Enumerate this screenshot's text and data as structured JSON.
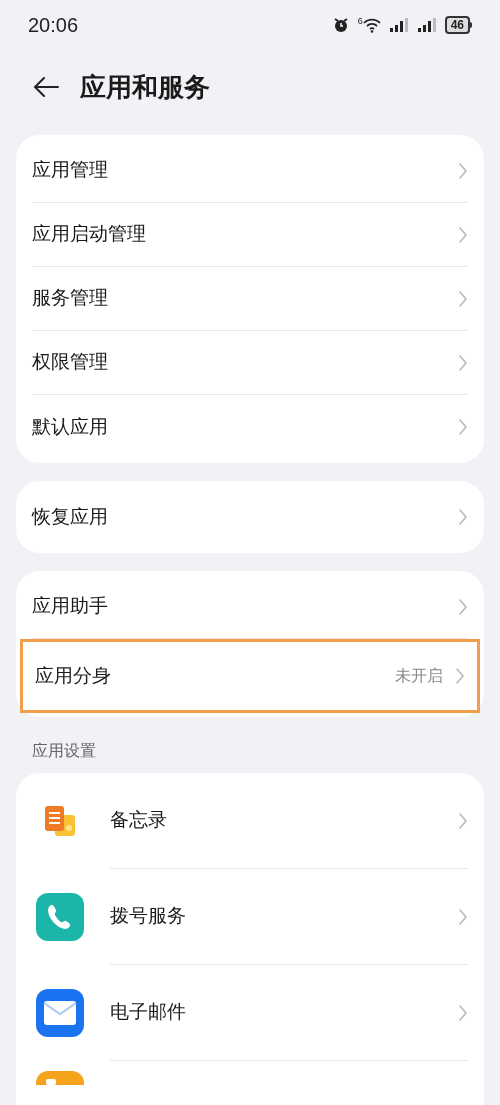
{
  "status_bar": {
    "time": "20:06",
    "alarm_superscript": "6",
    "battery": "46"
  },
  "header": {
    "title": "应用和服务"
  },
  "groups": [
    {
      "items": [
        {
          "label": "应用管理"
        },
        {
          "label": "应用启动管理"
        },
        {
          "label": "服务管理"
        },
        {
          "label": "权限管理"
        },
        {
          "label": "默认应用"
        }
      ]
    },
    {
      "items": [
        {
          "label": "恢复应用"
        }
      ]
    },
    {
      "items": [
        {
          "label": "应用助手",
          "highlighted": false
        },
        {
          "label": "应用分身",
          "value": "未开启",
          "highlighted": true
        }
      ]
    }
  ],
  "section": {
    "title": "应用设置"
  },
  "apps": [
    {
      "label": "备忘录",
      "kind": "notes"
    },
    {
      "label": "拨号服务",
      "kind": "phone"
    },
    {
      "label": "电子邮件",
      "kind": "mail"
    },
    {
      "kind": "folder"
    }
  ]
}
